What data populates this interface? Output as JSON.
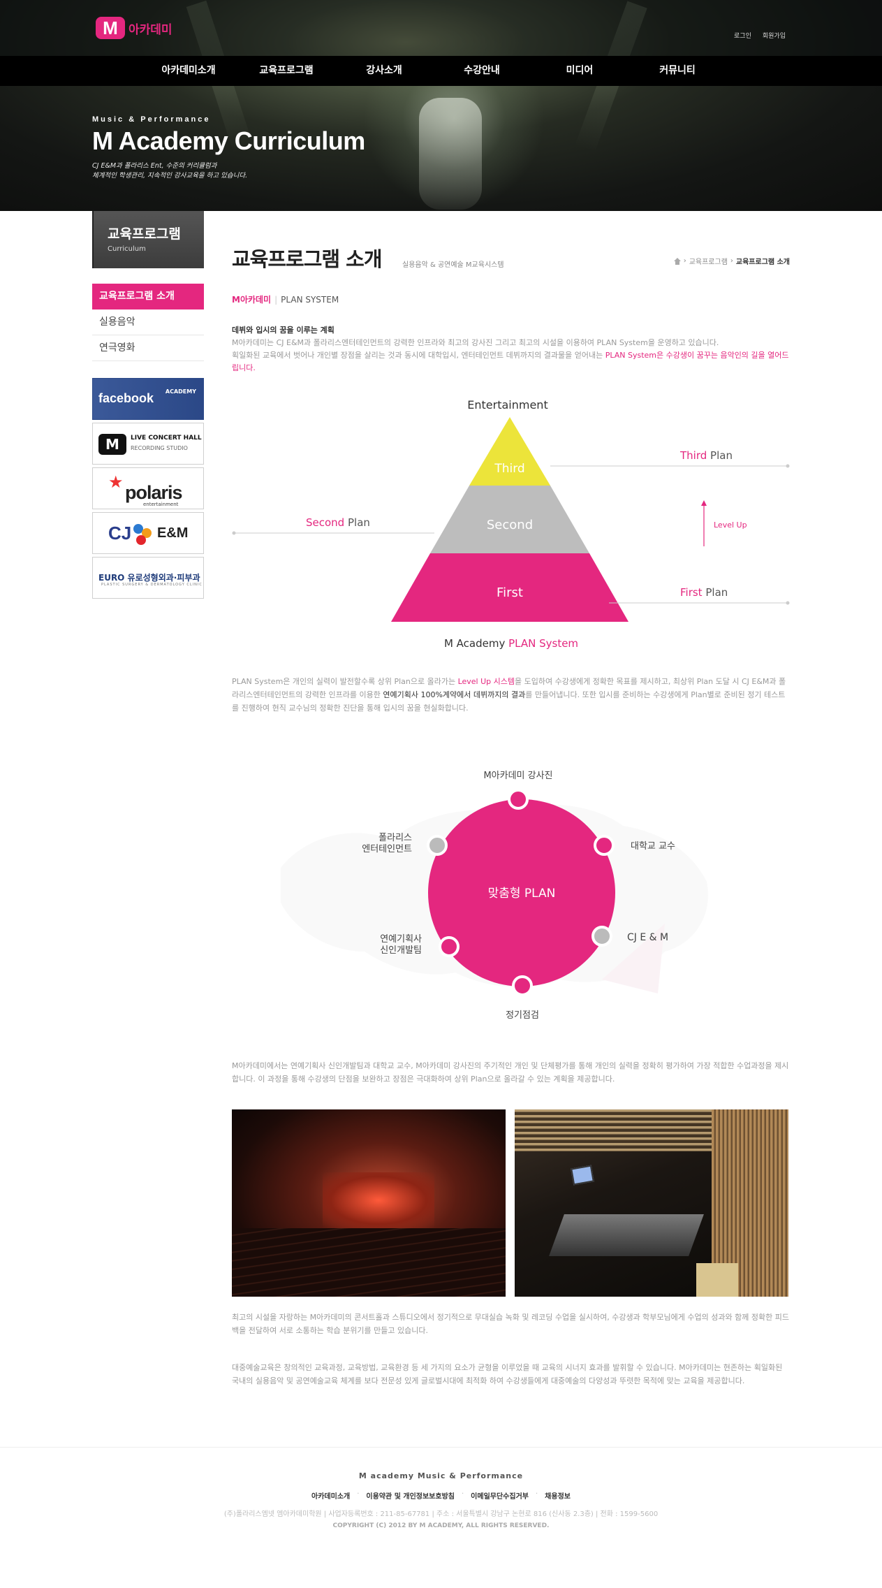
{
  "header": {
    "logo_mark": "M",
    "logo_text": "아카데미",
    "util_links": [
      "로그인",
      "회원가입"
    ],
    "gnb": [
      "아카데미소개",
      "교육프로그램",
      "강사소개",
      "수강안내",
      "미디어",
      "커뮤니티"
    ],
    "visual_sub": "Music & Performance",
    "visual_title": "M Academy Curriculum",
    "visual_desc": "CJ E&M과 폴라리스 Ent, 수준의 커리큘럼과\n체계적인 학생관리, 지속적인 강사교육을 하고 있습니다."
  },
  "sidebar": {
    "title": "교육프로그램",
    "subtitle": "Curriculum",
    "items": [
      {
        "label": "교육프로그램 소개",
        "active": true
      },
      {
        "label": "실용음악",
        "active": false
      },
      {
        "label": "연극영화",
        "active": false
      }
    ],
    "banners": {
      "facebook": "facebook",
      "facebook_sub": "ACADEMY",
      "live_title": "LIVE CONCERT HALL",
      "live_sub": "RECORDING STUDIO",
      "polaris": "polaris",
      "polaris_sub": "entertainment",
      "cj": "CJ",
      "cj_sub": "E&M",
      "euro": "EURO 유로성형외과·피부과",
      "euro_sub": "PLASTIC SURGERY & DERMATOLOGY CLINIC"
    }
  },
  "content": {
    "title": "교육프로그램 소개",
    "subtitle": "실용음악 & 공연예술 M교육시스템",
    "breadcrumb": [
      "교육프로그램",
      "교육프로그램 소개"
    ],
    "section_brand": "M아카데미",
    "section_name": "PLAN SYSTEM",
    "intro_head": "데뷔와 입시의 꿈을 이루는 계획",
    "intro_body_1": "M아카데미는 CJ E&M과 폴라리스엔터테인먼트의 강력한 인프라와 최고의 강사진 그리고 최고의 시설을 이용하여 PLAN System을 운영하고 있습니다.",
    "intro_body_2": "획일화된 교육에서 벗어나 개인별 장점을 살리는 것과 동시에 대학입시, 엔터테인먼트 데뷔까지의 결과물을 얻어내는 ",
    "intro_pink": "PLAN System은 수강생이 꿈꾸는 음악인의 길을 열어드립니다.",
    "pyramid": {
      "top_label": "Entertainment",
      "levels": [
        "Third",
        "Second",
        "First"
      ],
      "third_pink": "Third",
      "second_pink": "Second",
      "first_pink": "First",
      "plan_word": "Plan",
      "level_up": "Level Up",
      "caption_dark": "M Academy",
      "caption_pink": "PLAN System"
    },
    "para1_a": "PLAN System은 개인의 실력이 발전할수록 상위 Plan으로 올라가는 ",
    "para1_pink": "Level Up 시스템",
    "para1_b": "을 도입하여 수강생에게 정확한 목표를 제시하고, 최상위 Plan 도달 시 CJ E&M과 폴라리스엔터테인먼트의 강력한 인프라를 이용한 ",
    "para1_dark": "연예기획사 100%계약에서 데뷔까지의 결과",
    "para1_c": "를 만들어냅니다. 또한 입시를 준비하는 수강생에게 Plan별로 준비된 정기 테스트를 진행하여 현직 교수님의 정확한 진단을 통해 입시의 꿈을 현실화합니다.",
    "circle": {
      "center": "맞춤형 PLAN",
      "nodes": [
        "M아카데미 강사진",
        "대학교 교수",
        "CJ E & M",
        "정기점검",
        "연예기획사 신인개발팀",
        "폴라리스 엔터테인먼트"
      ]
    },
    "para2": "M아카데미에서는 연예기획사 신인개발팀과 대학교 교수, M아카데미 강사진의 주기적인 개인 및 단체평가를 통해 개인의 실력을 정확히 평가하여 가장 적합한 수업과정을 제시합니다. 이 과정을 통해 수강생의 단점을 보완하고 장점은 극대화하여 상위 Plan으로 올라갈 수 있는 계획을 제공합니다.",
    "para3": "최고의 시설을 자랑하는 M아카데미의 콘서트홀과 스튜디오에서 정기적으로 무대실습 녹화 및 레코딩 수업을 실시하여, 수강생과 학부모님에게 수업의 성과와 함께 정확한 피드백을 전달하여 서로 소통하는 학습 분위기를 만들고 있습니다.",
    "para4": "대중예술교육은 창의적인 교육과정, 교육방법, 교육환경 등 세 가지의 요소가 균형을 이루었을 때 교육의 시너지 효과를 발휘할 수 있습니다. M아카데미는 현존하는 획일화된 국내의 실용음악 및 공연예술교육 체계를 보다 전문성 있게 글로벌시대에 최적화 하여 수강생들에게 대중예술의 다양성과 뚜렷한 목적에 맞는 교육을 제공합니다."
  },
  "footer": {
    "brand": "M academy Music & Performance",
    "links": [
      "아카데미소개",
      "이용약관 및 개인정보보호방침",
      "이메일무단수집거부",
      "채용정보"
    ],
    "info": "(주)폴라리스엠넷 엠아카데미학원 | 사업자등록번호 : 211-85-67781 | 주소 : 서울특별시 강남구 논현로 816 (신사동 2.3층) | 전화 : 1599-5600",
    "copyright": "COPYRIGHT (C) 2012 BY M ACADEMY, ALL RIGHTS RESERVED."
  },
  "colors": {
    "accent": "#e4277f",
    "third": "#ece43a",
    "second": "#bdbdbd",
    "first": "#e4277f",
    "node_gray": "#bbbbbb"
  }
}
